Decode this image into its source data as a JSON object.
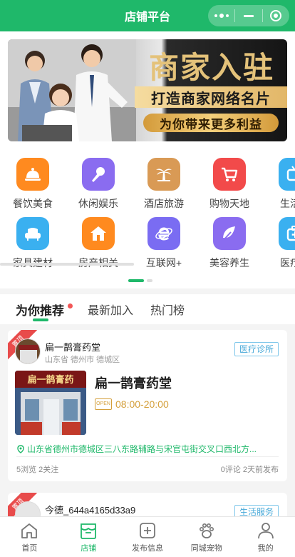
{
  "app": {
    "title": "店铺平台"
  },
  "banner": {
    "headline": "商家入驻",
    "subline": "打造商家网络名片",
    "slogan": "为你带来更多利益"
  },
  "categories": [
    {
      "label": "餐饮美食",
      "icon": "cloche-icon",
      "color": "#ff8a1f"
    },
    {
      "label": "休闲娱乐",
      "icon": "microphone-icon",
      "color": "#8a6cf0"
    },
    {
      "label": "酒店旅游",
      "icon": "palm-tree-icon",
      "color": "#d99a55"
    },
    {
      "label": "购物天地",
      "icon": "shopping-cart-icon",
      "color": "#f24a4a"
    },
    {
      "label": "生活服",
      "icon": "tv-icon",
      "color": "#3ab0f0"
    },
    {
      "label": "家具建材",
      "icon": "sofa-icon",
      "color": "#3ab0f0"
    },
    {
      "label": "房产相关",
      "icon": "house-icon",
      "color": "#ff8a1f"
    },
    {
      "label": "互联网+",
      "icon": "internet-explorer-icon",
      "color": "#7a6cf2"
    },
    {
      "label": "美容养生",
      "icon": "leaf-icon",
      "color": "#8a6cf0"
    },
    {
      "label": "医疗诊",
      "icon": "medical-kit-icon",
      "color": "#3ab0f0"
    }
  ],
  "tabs": [
    {
      "label": "为你推荐",
      "active": true
    },
    {
      "label": "最新加入",
      "active": false
    },
    {
      "label": "热门榜",
      "active": false
    }
  ],
  "listings": [
    {
      "badge": "置顶",
      "name": "扁一鹊膏药堂",
      "region": "山东省 德州市 德城区",
      "category": "医疗诊所",
      "title": "扁一鹊膏药堂",
      "open_label": "OPEN",
      "hours": "08:00-20:00",
      "address": "山东省德州市德城区三八东路辅路与宋官屯街交叉口西北方...",
      "stats_left": "5浏览 2关注",
      "stats_right": "0评论 2天前发布",
      "sign_text": "扁一鹊膏药"
    },
    {
      "badge": "置顶",
      "name": "今德_644a4165d33a9",
      "category": "生活服务"
    }
  ],
  "tabbar": [
    {
      "label": "首页",
      "icon": "home-icon",
      "active": false
    },
    {
      "label": "店铺",
      "icon": "store-icon",
      "active": true
    },
    {
      "label": "发布信息",
      "icon": "plus-square-icon",
      "active": false
    },
    {
      "label": "同城宠物",
      "icon": "paw-icon",
      "active": false
    },
    {
      "label": "我的",
      "icon": "user-icon",
      "active": false
    }
  ],
  "colors": {
    "primary": "#1fb86a",
    "accent_gold": "#d49f3a",
    "tag_blue": "#48a9d8",
    "hot_red": "#e84b4b"
  }
}
